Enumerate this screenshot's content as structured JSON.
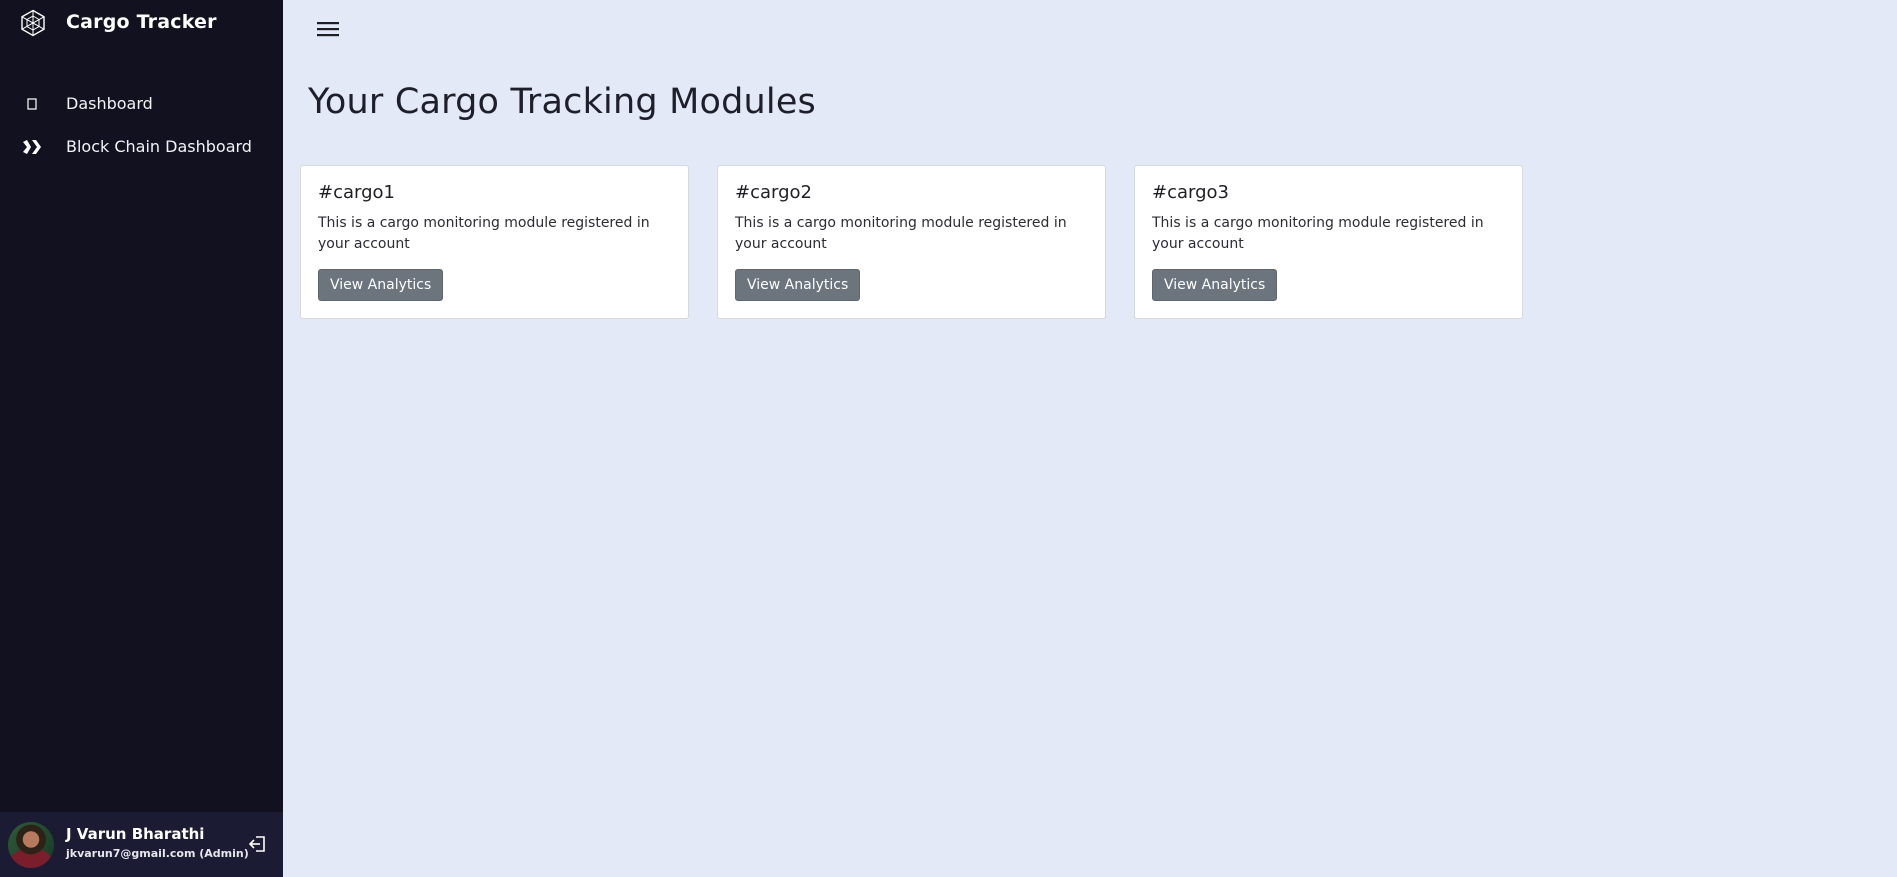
{
  "app": {
    "name": "Cargo Tracker"
  },
  "sidebar": {
    "items": [
      {
        "label": "Dashboard",
        "icon": "dashboard-icon"
      },
      {
        "label": "Block Chain Dashboard",
        "icon": "blockchain-icon"
      }
    ]
  },
  "user": {
    "name": "J Varun Bharathi",
    "email_role": "jkvarun7@gmail.com (Admin)",
    "logout_icon": "logout-icon"
  },
  "header": {
    "menu_icon": "hamburger-menu-icon"
  },
  "main": {
    "title": "Your Cargo Tracking Modules",
    "cards": [
      {
        "title": "#cargo1",
        "text": "This is a cargo monitoring module registered in your account",
        "button": "View Analytics"
      },
      {
        "title": "#cargo2",
        "text": "This is a cargo monitoring module registered in your account",
        "button": "View Analytics"
      },
      {
        "title": "#cargo3",
        "text": "This is a cargo monitoring module registered in your account",
        "button": "View Analytics"
      }
    ]
  },
  "colors": {
    "sidebar_bg": "#11111f",
    "page_bg": "#e3e9f6",
    "button_bg": "#6c747d",
    "user_panel_bg": "#1b1b33"
  }
}
